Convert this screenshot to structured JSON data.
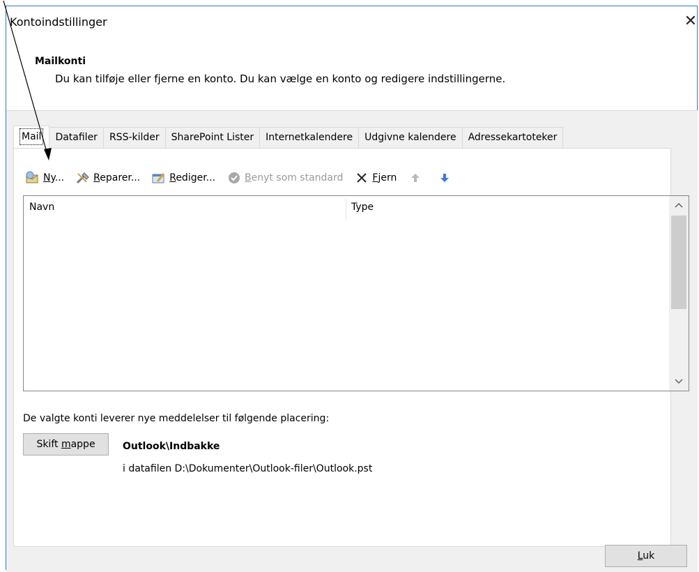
{
  "window": {
    "title": "Kontoindstillinger",
    "close_glyph": "✕"
  },
  "header": {
    "title": "Mailkonti",
    "subtitle": "Du kan tilføje eller fjerne en konto. Du kan vælge en konto og redigere indstillingerne."
  },
  "tabs": [
    {
      "label": "Mail",
      "active": true
    },
    {
      "label": "Datafiler"
    },
    {
      "label": "RSS-kilder"
    },
    {
      "label": "SharePoint Lister"
    },
    {
      "label": "Internetkalendere"
    },
    {
      "label": "Udgivne kalendere"
    },
    {
      "label": "Adressekartoteker"
    }
  ],
  "toolbar": {
    "new_key": "N",
    "new_rest": "y...",
    "repair_key": "R",
    "repair_rest": "eparer...",
    "edit_key": "R",
    "edit_rest": "ediger...",
    "default_key": "B",
    "default_rest": "enyt som standard",
    "remove_key": "F",
    "remove_rest": "jern"
  },
  "list": {
    "columns": [
      "Navn",
      "Type"
    ],
    "rows": []
  },
  "delivery": {
    "label": "De valgte konti leverer nye meddelelser til følgende placering:",
    "change_folder_before": "Skift ",
    "change_folder_key": "m",
    "change_folder_after": "appe",
    "folder": "Outlook\\Indbakke",
    "datafile": "i datafilen D:\\Dokumenter\\Outlook-filer\\Outlook.pst"
  },
  "footer": {
    "close_key": "L",
    "close_rest": "uk"
  },
  "colors": {
    "accent": "#2b79d0",
    "body_bg": "#f0f0f0",
    "blue_arrow": "#3a78e8"
  }
}
